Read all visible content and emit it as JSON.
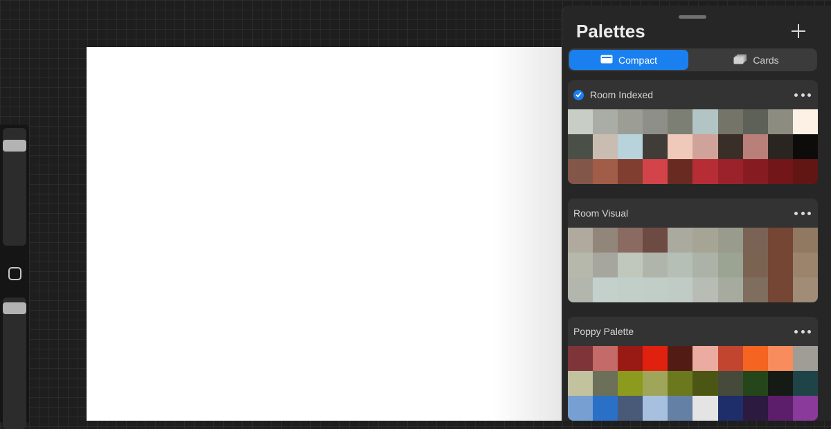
{
  "panel": {
    "title": "Palettes",
    "view_modes": [
      {
        "label": "Compact",
        "active": true
      },
      {
        "label": "Cards",
        "active": false
      }
    ],
    "accent_color": "#1a80f0"
  },
  "palettes": [
    {
      "name": "Room Indexed",
      "selected": true,
      "colors": [
        "#c8cdc6",
        "#a9ada5",
        "#9c9e96",
        "#8d8f88",
        "#7c8074",
        "#b2c4c4",
        "#747469",
        "#5e6158",
        "#8c8c80",
        "#fdf0e4",
        "#4a5047",
        "#c9bdb1",
        "#b8d3db",
        "#403d39",
        "#efc9b9",
        "#d0a39a",
        "#3a2f28",
        "#b88079",
        "#2b2522",
        "#0e0c0a",
        "#83564a",
        "#a15d48",
        "#803e30",
        "#d3434a",
        "#692a22",
        "#b62d36",
        "#9b222a",
        "#861c22",
        "#72161a",
        "#611614"
      ]
    },
    {
      "name": "Room Visual",
      "selected": false,
      "colors": [
        "#b0aa9e",
        "#918679",
        "#8a6a61",
        "#6e4b42",
        "#aaab9e",
        "#a6a494",
        "#999c8c",
        "#7a6354",
        "#744633",
        "#917861",
        "#b6b8ac",
        "#a6a69e",
        "#c0c8bd",
        "#b0b5ab",
        "#b6bfb6",
        "#acb2a8",
        "#9ba393",
        "#7b6352",
        "#744633",
        "#9c846c",
        "#b3b6ad",
        "#c3d0cb",
        "#c2cfc9",
        "#c1cdc7",
        "#c0cbc5",
        "#b7bcb4",
        "#a5ab9f",
        "#7f6d5e",
        "#744633",
        "#a08c77"
      ]
    },
    {
      "name": "Poppy Palette",
      "selected": false,
      "colors": [
        "#7e3438",
        "#c46a68",
        "#991a14",
        "#e0210f",
        "#521c15",
        "#ecaba0",
        "#c24530",
        "#f56420",
        "#f98c5c",
        "#a09c96",
        "#c3c29f",
        "#6d7058",
        "#8c9a1e",
        "#9fa65a",
        "#6c781e",
        "#4c5614",
        "#464a3a",
        "#24461a",
        "#161a14",
        "#1e4448",
        "#779fd2",
        "#2a70c6",
        "#485a78",
        "#a8c0e0",
        "#6480a4",
        "#e4e4e4",
        "#1e2e6a",
        "#2c1a40",
        "#5c1e6a",
        "#8a3a9a"
      ]
    }
  ]
}
